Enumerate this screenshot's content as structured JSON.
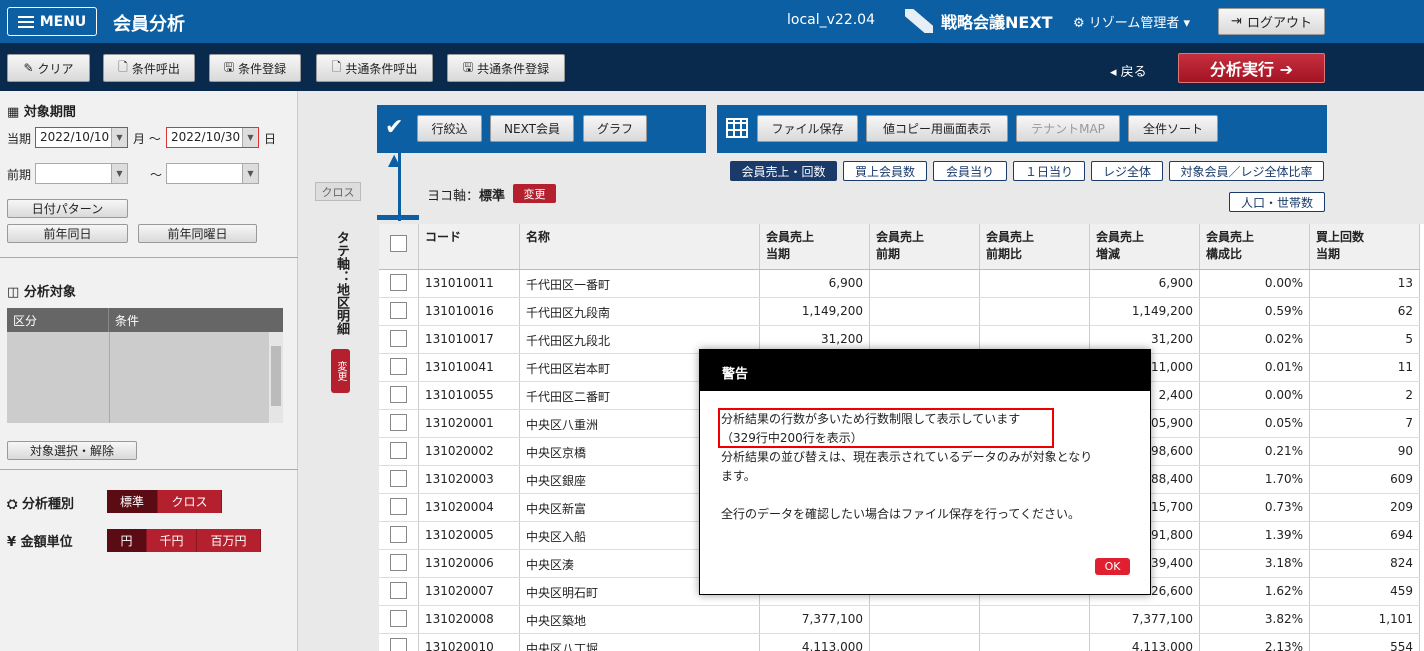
{
  "header": {
    "menu_label": "MENU",
    "app_title": "会員分析",
    "version": "local_v22.04",
    "brand": "戦略会議NEXT",
    "user": "⚙ リゾーム管理者 ▾",
    "logout_label": "ログアウト"
  },
  "toolbar": {
    "clear_label": "クリア",
    "load_condition_label": "条件呼出",
    "save_condition_label": "条件登録",
    "load_shared_label": "共通条件呼出",
    "save_shared_label": "共通条件登録",
    "back_label": "◂ 戻る",
    "run_label": "分析実行 ➔"
  },
  "sidebar": {
    "period_title": "対象期間",
    "current_label": "当期",
    "current_start": "2022/10/10",
    "month_label": "月 ～",
    "current_end": "2022/10/30",
    "day_label": "日",
    "prev_label": "前期",
    "tilde": "～",
    "date_pattern_label": "日付パターン",
    "prev_year_same_day": "前年同日",
    "prev_year_same_weekday": "前年同曜日",
    "target_title": "分析対象",
    "target_col1": "区分",
    "target_col2": "条件",
    "select_target_label": "対象選択・解除",
    "analysis_type_label": "分析種別",
    "analysis_types": [
      "標準",
      "クロス"
    ],
    "unit_label": "金額単位",
    "units": [
      "円",
      "千円",
      "百万円"
    ]
  },
  "vertical": {
    "cross_label": "クロス",
    "axis_label": "タテ軸：地区明細",
    "change_label": "変更"
  },
  "main": {
    "left_buttons": [
      "行絞込",
      "NEXT会員",
      "グラフ"
    ],
    "right_buttons": [
      "ファイル保存",
      "値コピー用画面表示",
      "テナントMAP",
      "全件ソート"
    ],
    "filters_row1": [
      "会員売上・回数",
      "買上会員数",
      "会員当り",
      "１日当り",
      "レジ全体",
      "対象会員／レジ全体比率"
    ],
    "filters_row2": [
      "人口・世帯数"
    ],
    "yoko_label": "ヨコ軸：",
    "yoko_value": "標準",
    "yoko_change": "変更"
  },
  "table": {
    "headers": [
      {
        "l1": "コード",
        "l2": ""
      },
      {
        "l1": "名称",
        "l2": ""
      },
      {
        "l1": "会員売上",
        "l2": "当期"
      },
      {
        "l1": "会員売上",
        "l2": "前期"
      },
      {
        "l1": "会員売上",
        "l2": "前期比"
      },
      {
        "l1": "会員売上",
        "l2": "増減"
      },
      {
        "l1": "会員売上",
        "l2": "構成比"
      },
      {
        "l1": "買上回数",
        "l2": "当期"
      }
    ],
    "rows": [
      {
        "code": "131010011",
        "name": "千代田区一番町",
        "cur": "6,900",
        "prev": "",
        "ratio": "",
        "diff": "6,900",
        "share": "0.00%",
        "count": "13"
      },
      {
        "code": "131010016",
        "name": "千代田区九段南",
        "cur": "1,149,200",
        "prev": "",
        "ratio": "",
        "diff": "1,149,200",
        "share": "0.59%",
        "count": "62"
      },
      {
        "code": "131010017",
        "name": "千代田区九段北",
        "cur": "31,200",
        "prev": "",
        "ratio": "",
        "diff": "31,200",
        "share": "0.02%",
        "count": "5"
      },
      {
        "code": "131010041",
        "name": "千代田区岩本町",
        "cur": "",
        "prev": "",
        "ratio": "",
        "diff": "11,000",
        "share": "0.01%",
        "count": "11"
      },
      {
        "code": "131010055",
        "name": "千代田区二番町",
        "cur": "",
        "prev": "",
        "ratio": "",
        "diff": "2,400",
        "share": "0.00%",
        "count": "2"
      },
      {
        "code": "131020001",
        "name": "中央区八重洲",
        "cur": "",
        "prev": "",
        "ratio": "",
        "diff": "105,900",
        "share": "0.05%",
        "count": "7"
      },
      {
        "code": "131020002",
        "name": "中央区京橋",
        "cur": "",
        "prev": "",
        "ratio": "",
        "diff": "398,600",
        "share": "0.21%",
        "count": "90"
      },
      {
        "code": "131020003",
        "name": "中央区銀座",
        "cur": "",
        "prev": "",
        "ratio": "",
        "diff": "288,400",
        "share": "1.70%",
        "count": "609"
      },
      {
        "code": "131020004",
        "name": "中央区新富",
        "cur": "",
        "prev": "",
        "ratio": "",
        "diff": "415,700",
        "share": "0.73%",
        "count": "209"
      },
      {
        "code": "131020005",
        "name": "中央区入船",
        "cur": "",
        "prev": "",
        "ratio": "",
        "diff": "591,800",
        "share": "1.39%",
        "count": "694"
      },
      {
        "code": "131020006",
        "name": "中央区湊",
        "cur": "",
        "prev": "",
        "ratio": "",
        "diff": "139,400",
        "share": "3.18%",
        "count": "824"
      },
      {
        "code": "131020007",
        "name": "中央区明石町",
        "cur": "",
        "prev": "",
        "ratio": "",
        "diff": "126,600",
        "share": "1.62%",
        "count": "459"
      },
      {
        "code": "131020008",
        "name": "中央区築地",
        "cur": "7,377,100",
        "prev": "",
        "ratio": "",
        "diff": "7,377,100",
        "share": "3.82%",
        "count": "1,101"
      },
      {
        "code": "131020010",
        "name": "中央区八丁堀",
        "cur": "4,113,000",
        "prev": "",
        "ratio": "",
        "diff": "4,113,000",
        "share": "2.13%",
        "count": "554"
      }
    ]
  },
  "dialog": {
    "title": "警告",
    "line1": "分析結果の行数が多いため行数制限して表示しています",
    "line2": "（329行中200行を表示）",
    "line3": "分析結果の並び替えは、現在表示されているデータのみが対象となり",
    "line4": "ます。",
    "line5": "全行のデータを確認したい場合はファイル保存を行ってください。",
    "ok_label": "OK"
  }
}
